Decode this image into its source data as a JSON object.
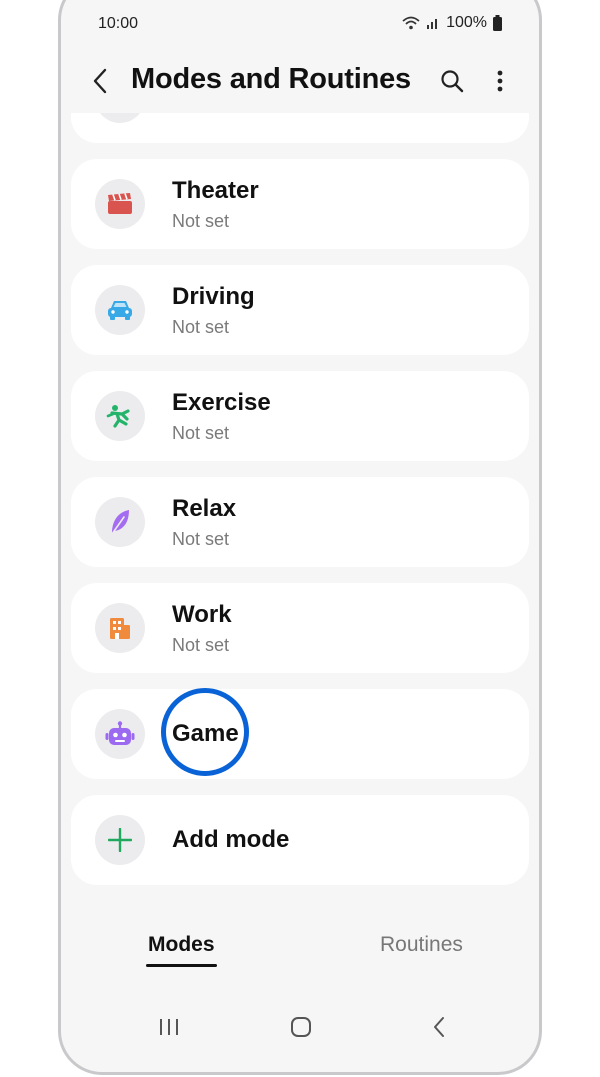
{
  "status": {
    "time": "10:00",
    "battery": "100%"
  },
  "appbar": {
    "title": "Modes and Routines"
  },
  "modes": [
    {
      "title": "Theater",
      "subtitle": "Not set",
      "icon": "clapperboard-icon",
      "color": "#d9534f"
    },
    {
      "title": "Driving",
      "subtitle": "Not set",
      "icon": "car-icon",
      "color": "#38a8e6"
    },
    {
      "title": "Exercise",
      "subtitle": "Not set",
      "icon": "running-icon",
      "color": "#24b36b"
    },
    {
      "title": "Relax",
      "subtitle": "Not set",
      "icon": "leaf-icon",
      "color": "#a46cf0"
    },
    {
      "title": "Work",
      "subtitle": "Not set",
      "icon": "building-icon",
      "color": "#f08a3c"
    },
    {
      "title": "Game",
      "icon": "robot-icon",
      "color": "#9b6af0",
      "highlighted": true
    }
  ],
  "add_mode": {
    "label": "Add mode",
    "color": "#1fa85e"
  },
  "tabs": {
    "modes": "Modes",
    "routines": "Routines",
    "selected": "Modes"
  },
  "colors": {
    "highlight_ring": "#0a63d6",
    "background": "#f6f6f7",
    "card": "#ffffff"
  }
}
